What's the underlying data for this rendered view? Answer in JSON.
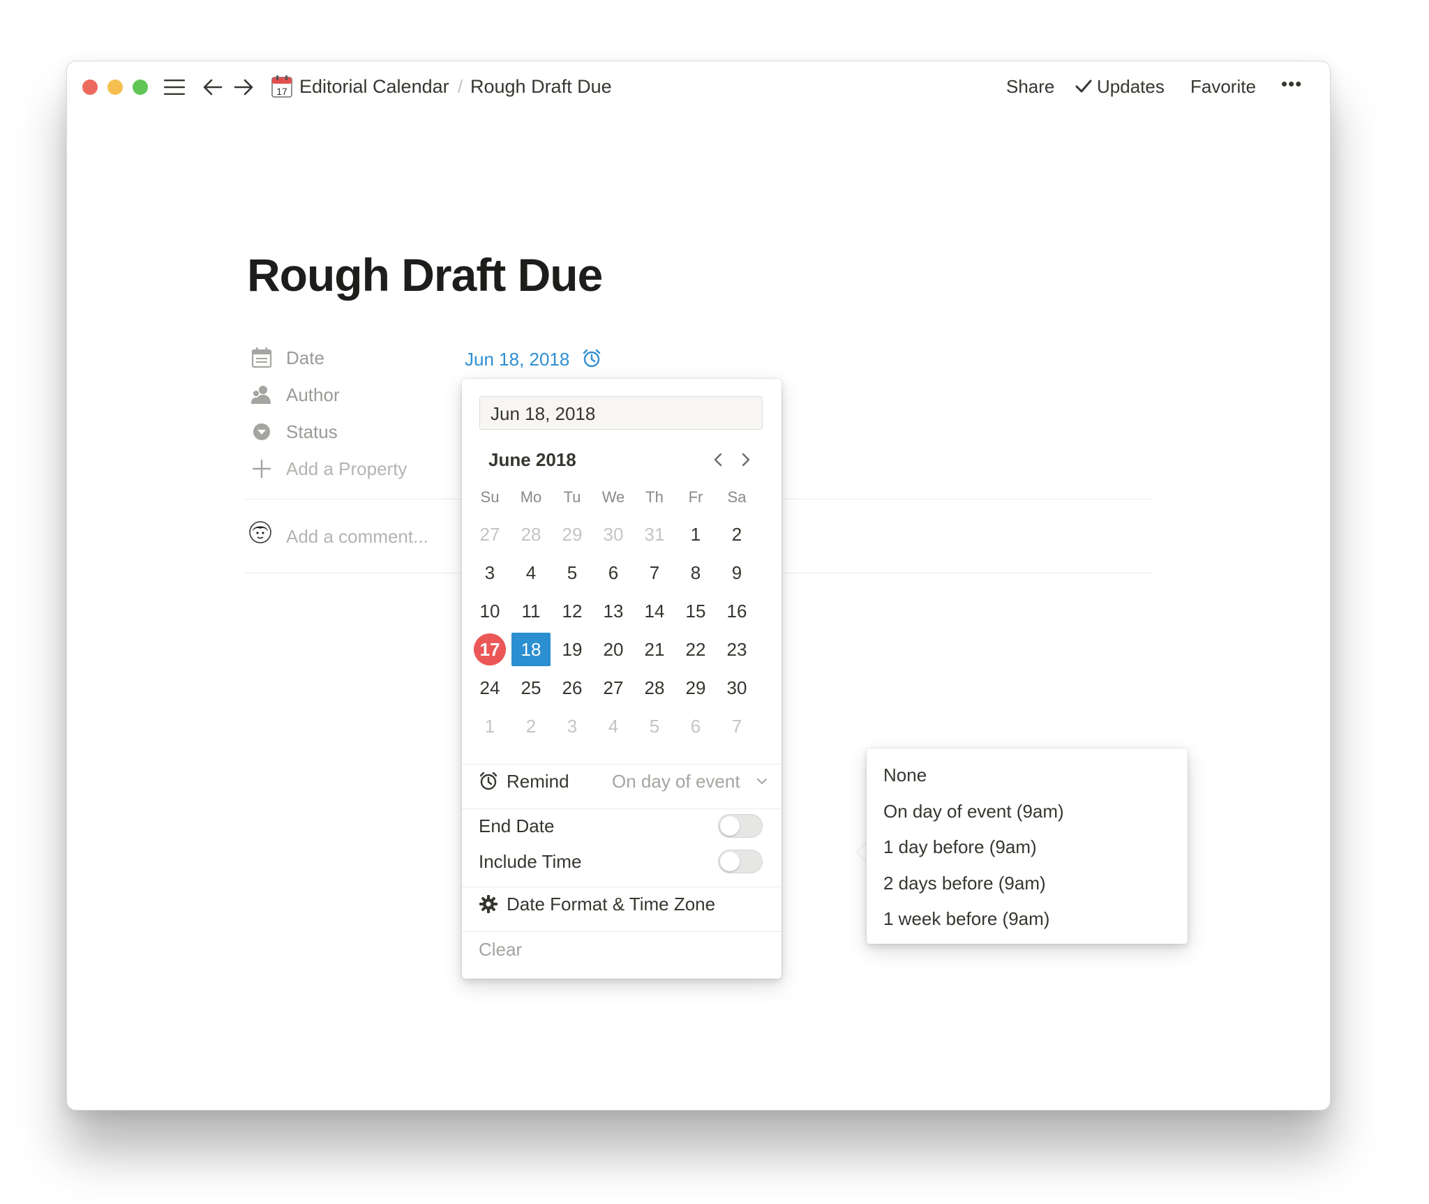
{
  "titlebar": {
    "breadcrumb_parent_icon": "calendar-17-icon",
    "breadcrumb_parent": "Editorial Calendar",
    "breadcrumb_separator": "/",
    "breadcrumb_current": "Rough Draft Due",
    "share_label": "Share",
    "updates_label": "Updates",
    "favorite_label": "Favorite",
    "more_label": "•••",
    "traffic_colors": [
      "#ed6a5e",
      "#f5bf4f",
      "#61c554"
    ]
  },
  "page": {
    "title": "Rough Draft Due",
    "properties": [
      {
        "icon": "calendar-icon",
        "label": "Date"
      },
      {
        "icon": "person-icon",
        "label": "Author"
      },
      {
        "icon": "status-icon",
        "label": "Status"
      },
      {
        "icon": "plus-icon",
        "label": "Add a Property"
      }
    ],
    "date_value": "Jun 18, 2018",
    "comment_placeholder": "Add a comment..."
  },
  "date_popup": {
    "input_value": "Jun 18, 2018",
    "month_label": "June 2018",
    "weekdays": [
      "Su",
      "Mo",
      "Tu",
      "We",
      "Th",
      "Fr",
      "Sa"
    ],
    "weeks": [
      [
        "27",
        "28",
        "29",
        "30",
        "31",
        "1",
        "2"
      ],
      [
        "3",
        "4",
        "5",
        "6",
        "7",
        "8",
        "9"
      ],
      [
        "10",
        "11",
        "12",
        "13",
        "14",
        "15",
        "16"
      ],
      [
        "17",
        "18",
        "19",
        "20",
        "21",
        "22",
        "23"
      ],
      [
        "24",
        "25",
        "26",
        "27",
        "28",
        "29",
        "30"
      ],
      [
        "1",
        "2",
        "3",
        "4",
        "5",
        "6",
        "7"
      ]
    ],
    "today": "17",
    "selected": "18",
    "remind_label": "Remind",
    "remind_value": "On day of event",
    "end_date_label": "End Date",
    "end_date_on": false,
    "include_time_label": "Include Time",
    "include_time_on": false,
    "date_format_label": "Date Format & Time Zone",
    "clear_label": "Clear",
    "accent_selected": "#2b8fd1",
    "accent_today": "#eb5757"
  },
  "remind_menu": {
    "items": [
      "None",
      "On day of event (9am)",
      "1 day before (9am)",
      "2 days before (9am)",
      "1 week before (9am)"
    ]
  },
  "help_label": "?"
}
